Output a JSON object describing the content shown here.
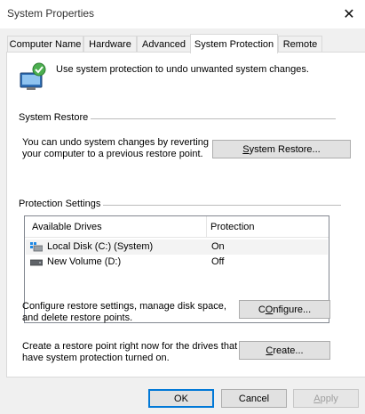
{
  "window": {
    "title": "System Properties",
    "close_symbol": "✕"
  },
  "tabs": [
    {
      "label": "Computer Name"
    },
    {
      "label": "Hardware"
    },
    {
      "label": "Advanced"
    },
    {
      "label": "System Protection"
    },
    {
      "label": "Remote"
    }
  ],
  "active_tab": "System Protection",
  "intro": {
    "text": "Use system protection to undo unwanted system changes."
  },
  "system_restore": {
    "heading": "System Restore",
    "description_line1": "You can undo system changes by reverting",
    "description_line2": "your computer to a previous restore point.",
    "button_mnemonic": "S",
    "button_rest": "ystem Restore..."
  },
  "protection_settings": {
    "heading": "Protection Settings",
    "columns": [
      "Available Drives",
      "Protection"
    ],
    "drives": [
      {
        "name": "Local Disk (C:) (System)",
        "protection": "On",
        "icon": "system-drive-icon"
      },
      {
        "name": "New Volume (D:)",
        "protection": "Off",
        "icon": "drive-icon"
      }
    ],
    "configure_line1": "Configure restore settings, manage disk space,",
    "configure_line2": "and delete restore points.",
    "configure_mnemonic": "O",
    "configure_pre": "C",
    "configure_rest": "nfigure...",
    "create_line1": "Create a restore point right now for the drives that",
    "create_line2": "have system protection turned on.",
    "create_mnemonic": "C",
    "create_rest": "reate..."
  },
  "footer": {
    "ok": "OK",
    "cancel": "Cancel",
    "apply_mnemonic": "A",
    "apply_rest": "pply"
  },
  "colors": {
    "accent": "#0078d7",
    "selection": "#f3f3f3"
  }
}
